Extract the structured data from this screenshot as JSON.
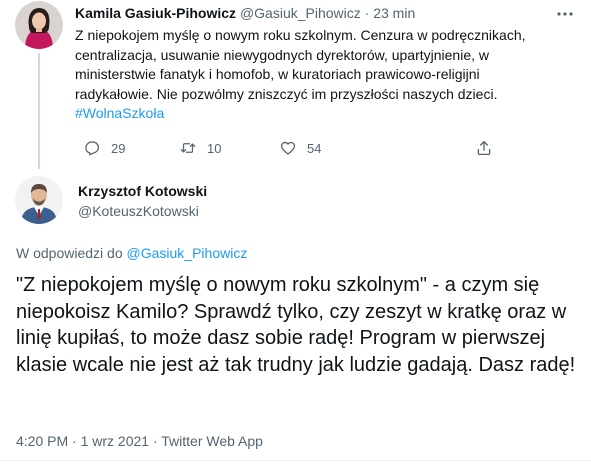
{
  "parent_tweet": {
    "author_name": "Kamila Gasiuk-Pihowicz",
    "author_handle": "@Gasiuk_Pihowicz",
    "separator": "·",
    "time": "23 min",
    "text": "Z niepokojem myślę o nowym roku szkolnym. Cenzura w podręcznikach, centralizacja, usuwanie niewygodnych dyrektorów, upartyjnienie, w ministerstwie fanatyk i homofob, w kuratoriach prawicowo-religijni radykałowie. Nie pozwólmy zniszczyć im przyszłości naszych dzieci.",
    "hashtag": "#WolnaSzkoła",
    "stats": {
      "replies": "29",
      "retweets": "10",
      "likes": "54"
    },
    "icons": {
      "reply": "reply-icon",
      "retweet": "retweet-icon",
      "like": "like-icon",
      "share": "share-icon",
      "more": "more-icon"
    }
  },
  "main_tweet": {
    "author_name": "Krzysztof Kotowski",
    "author_handle": "@KoteuszKotowski",
    "reply_prefix": "W odpowiedzi do",
    "reply_target": "@Gasiuk_Pihowicz",
    "text": "\"Z niepokojem myślę o nowym roku szkolnym\" - a czym się niepokoisz Kamilo? Sprawdź tylko, czy zeszyt w kratkę oraz w linię kupiłaś, to może dasz sobie radę! Program w pierwszej klasie wcale nie jest aż tak trudny jak ludzie gadają. Dasz radę!",
    "timestamp": "4:20 PM · 1 wrz 2021 ·",
    "source": "Twitter Web App"
  },
  "colors": {
    "text_primary": "#0f1419",
    "text_secondary": "#536471",
    "accent": "#1d9bf0",
    "thread_line": "#cfd9de"
  }
}
